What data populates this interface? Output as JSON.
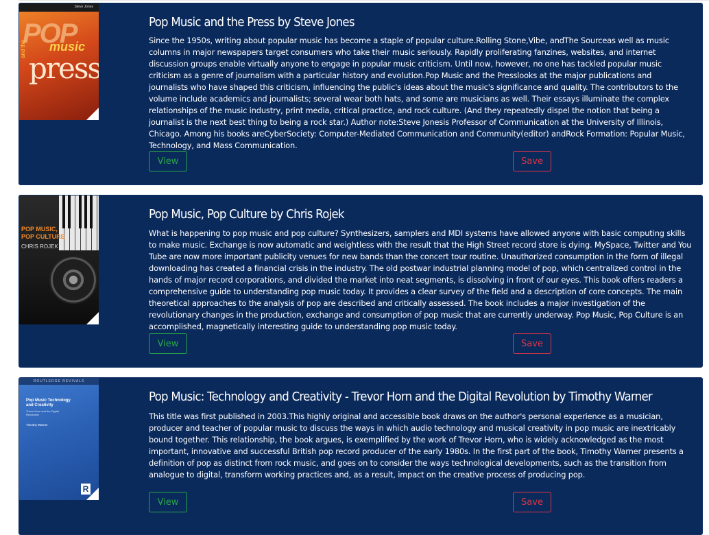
{
  "books": [
    {
      "title": "Pop Music and the Press by Steve Jones",
      "description": "Since the 1950s, writing about popular music has become a staple of popular culture.Rolling Stone,Vibe, andThe Sourceas well as music columns in major newspapers target consumers who take their music seriously. Rapidly proliferating fanzines, websites, and internet discussion groups enable virtually anyone to engage in popular music criticism. Until now, however, no one has tackled popular music criticism as a genre of journalism with a particular history and evolution.Pop Music and the Presslooks at the major publications and journalists who have shaped this criticism, influencing the public's ideas about the music's significance and quality. The contributors to the volume include academics and journalists; several wear both hats, and some are musicians as well. Their essays illuminate the complex relationships of the music industry, print media, critical practice, and rock culture. (And they repeatedly dispel the notion that being a journalist is the next best thing to being a rock star.) Author note:Steve Jonesis Professor of Communication at the University of Illinois, Chicago. Among his books areCyberSociety: Computer-Mediated Communication and Community(editor) andRock Formation: Popular Music, Technology, and Mass Communication.",
      "view_label": "View",
      "save_label": "Save",
      "cover": {
        "author": "Steve Jones",
        "pop": "POP",
        "music": "music",
        "andthe": "and the",
        "press": "press"
      }
    },
    {
      "title": "Pop Music, Pop Culture by Chris Rojek",
      "description": "What is happening to pop music and pop culture? Synthesizers, samplers and MDI systems have allowed anyone with basic computing skills to make music. Exchange is now automatic and weightless with the result that the High Street record store is dying. MySpace, Twitter and You Tube are now more important publicity venues for new bands than the concert tour routine. Unauthorized consumption in the form of illegal downloading has created a financial crisis in the industry. The old postwar industrial planning model of pop, which centralized control in the hands of major record corporations, and divided the market into neat segments, is dissolving in front of our eyes. This book offers readers a comprehensive guide to understanding pop music today. It provides a clear survey of the field and a description of core concepts. The main theoretical approaches to the analysis of pop are described and critically assessed. The book includes a major investigation of the revolutionary changes in the production, exchange and consumption of pop music that are currently underway. Pop Music, Pop Culture is an accomplished, magnetically interesting guide to understanding pop music today.",
      "view_label": "View",
      "save_label": "Save",
      "cover": {
        "title_line1": "POP MUSIC,",
        "title_line2": "POP CULTURE",
        "author": "CHRIS ROJEK"
      }
    },
    {
      "title": "Pop Music: Technology and Creativity - Trevor Horn and the Digital Revolution by Timothy Warner",
      "description": "This title was first published in 2003.This highly original and accessible book draws on the author's personal experience as a musician, producer and teacher of popular music to discuss the ways in which audio technology and musical creativity in pop music are inextricably bound together. This relationship, the book argues, is exemplified by the work of Trevor Horn, who is widely acknowledged as the most important, innovative and successful British pop record producer of the early 1980s. In the first part of the book, Timothy Warner presents a definition of pop as distinct from rock music, and goes on to consider the ways technological developments, such as the transition from analogue to digital, transform working practices and, as a result, impact on the creative process of producing pop.",
      "view_label": "View",
      "save_label": "Save",
      "cover": {
        "series": "ROUTLEDGE REVIVALS",
        "title_line1": "Pop Music Technology",
        "title_line2": "and Creativity",
        "subtitle_line1": "Trevor Horn and the Digital",
        "subtitle_line2": "Revolution",
        "author": "Timothy Warner",
        "logo": "R"
      }
    }
  ],
  "colors": {
    "card_bg": "#0b2a5c",
    "view": "#28a745",
    "save": "#dc3545"
  }
}
